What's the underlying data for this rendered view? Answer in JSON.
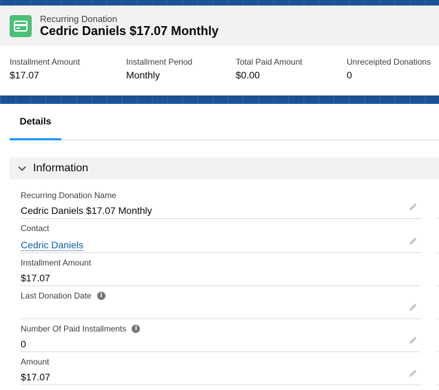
{
  "record": {
    "type": "Recurring Donation",
    "title": "Cedric Daniels $17.07 Monthly",
    "icon": "recurring-donation-icon",
    "icon_color": "#4bc076"
  },
  "highlights": [
    {
      "label": "Installment Amount",
      "value": "$17.07"
    },
    {
      "label": "Installment Period",
      "value": "Monthly"
    },
    {
      "label": "Total Paid Amount",
      "value": "$0.00"
    },
    {
      "label": "Unreceipted Donations",
      "value": "0"
    }
  ],
  "tabs": [
    {
      "label": "Details",
      "active": true
    }
  ],
  "section": {
    "title": "Information",
    "expanded": true
  },
  "fields": [
    {
      "label": "Recurring Donation Name",
      "value": "Cedric Daniels $17.07 Monthly",
      "editable": true
    },
    {
      "label": "Contact",
      "value": "Cedric Daniels",
      "link": true,
      "editable": true
    },
    {
      "label": "Installment Amount",
      "value": "$17.07",
      "editable": false
    },
    {
      "label": "Last Donation Date",
      "value": "",
      "info": true,
      "editable": true
    },
    {
      "label": "Number Of Paid Installments",
      "value": "0",
      "info": true,
      "editable": true
    },
    {
      "label": "Amount",
      "value": "$17.07",
      "editable": true
    }
  ],
  "colors": {
    "accent": "#1b96ff",
    "link": "#0b5cab",
    "brand_band": "#1b5297"
  }
}
